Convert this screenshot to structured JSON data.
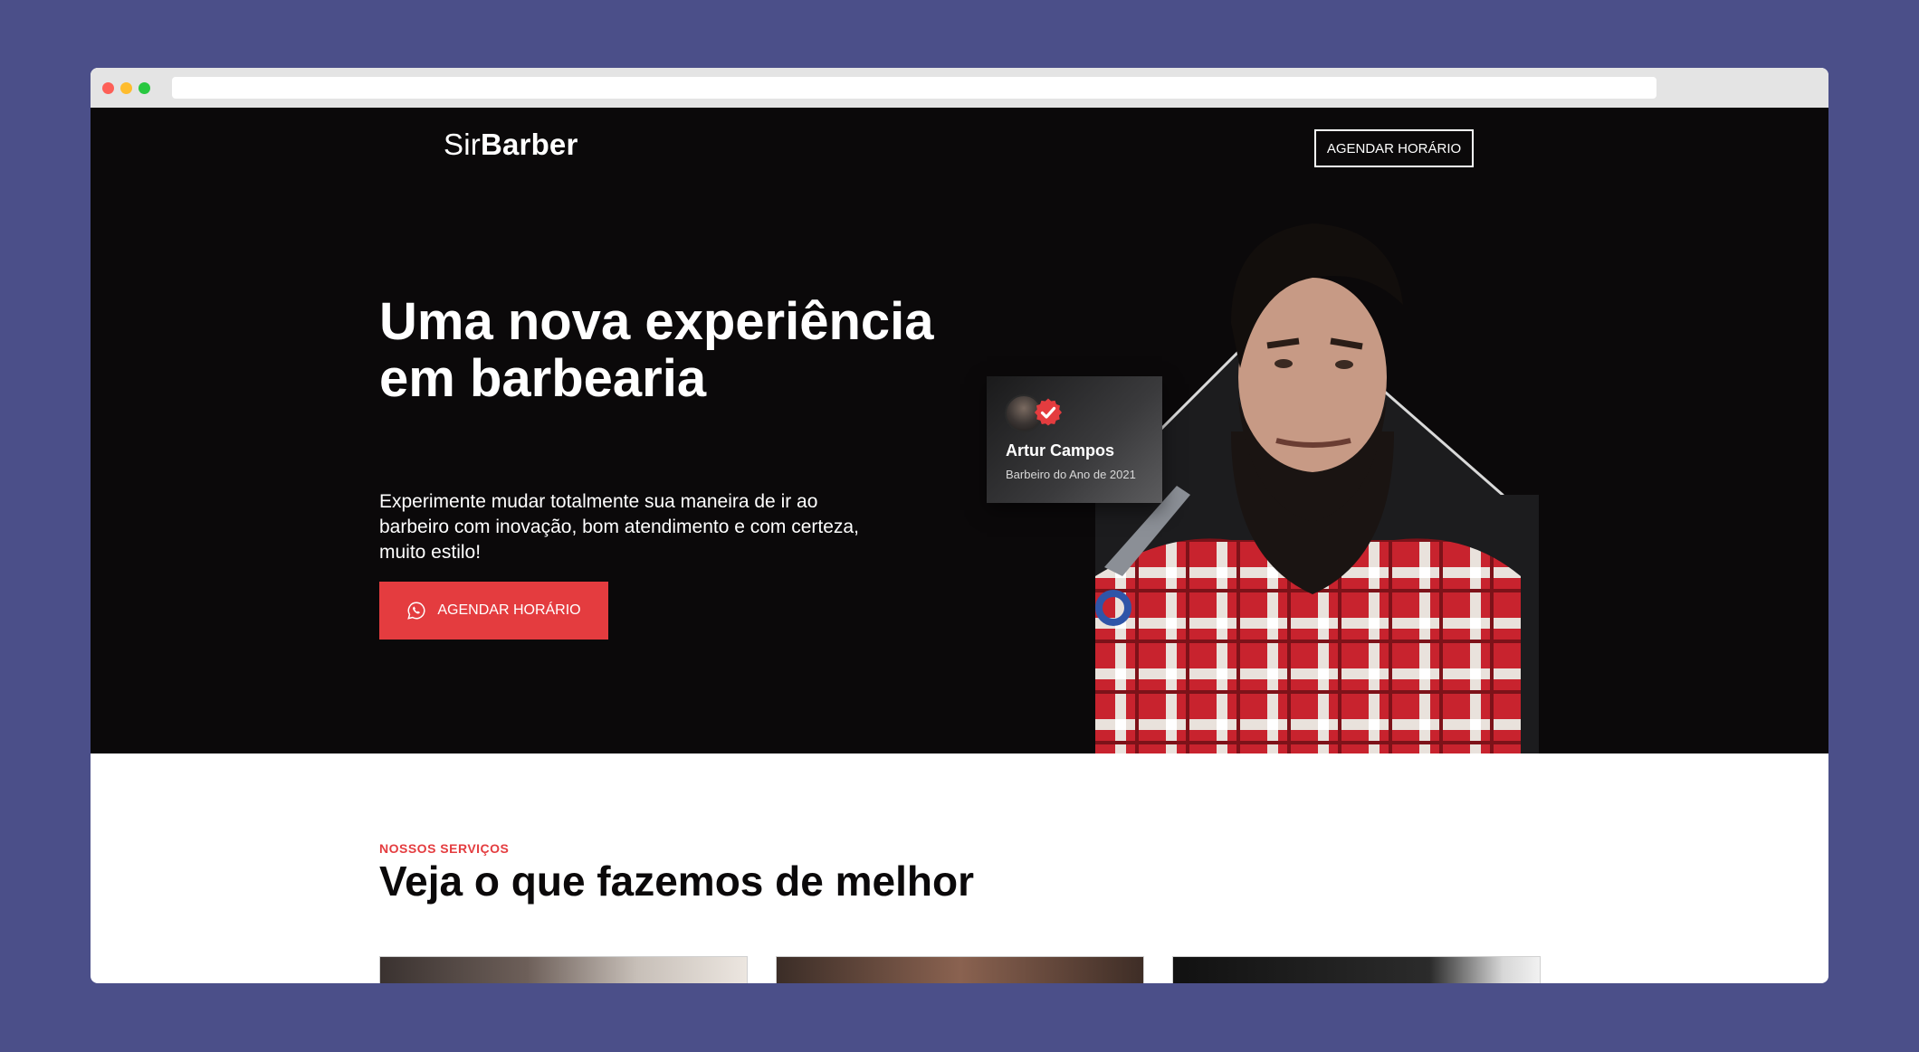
{
  "header": {
    "logo_light": "Sir",
    "logo_bold": "Barber",
    "cta_label": "AGENDAR HORÁRIO"
  },
  "hero": {
    "title": "Uma nova experiência em barbearia",
    "description": "Experimente mudar totalmente sua maneira de ir ao barbeiro com inovação, bom atendimento e com certeza, muito estilo!",
    "cta_label": "AGENDAR HORÁRIO",
    "cta_icon": "whatsapp-icon"
  },
  "badge": {
    "name": "Artur Campos",
    "subtitle": "Barbeiro do Ano de 2021",
    "icon": "verified-check-icon"
  },
  "services": {
    "label": "NOSSOS SERVIÇOS",
    "title": "Veja o que fazemos de melhor",
    "cards": [
      "service-card-1",
      "service-card-2",
      "service-card-3"
    ]
  },
  "colors": {
    "page_background": "#4b4f89",
    "hero_background": "#0b090a",
    "accent": "#e43c3f",
    "text_light": "#ffffff",
    "text_dark": "#0b090a"
  }
}
